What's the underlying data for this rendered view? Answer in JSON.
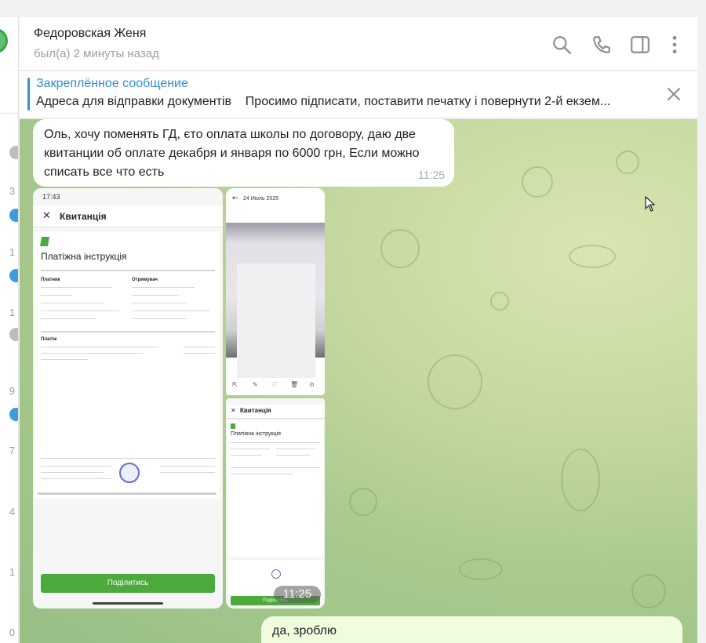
{
  "chat": {
    "title": "Федоровская Женя",
    "status": "был(а) 2 минуты назад"
  },
  "sidebar_partial": {
    "numbers": [
      "3",
      "1",
      "1",
      "9",
      "7",
      "4",
      "1",
      "0"
    ]
  },
  "pinned": {
    "title": "Закреплённое сообщение",
    "text": "Адреса для відправки документів    Просимо підписати, поставити печатку і повернути 2-й екзем..."
  },
  "messages": [
    {
      "direction": "in",
      "text": "Оль, хочу поменять ГД, єто оплата школы по договору, даю две квитанции об оплате декабря и января по 6000 грн, Если можно списать все что есть",
      "time": "11:25"
    },
    {
      "direction": "in",
      "type": "album",
      "time": "11:25",
      "shots": [
        {
          "status_time": "17:43",
          "title": "Квитанція",
          "doc_heading": "Платіжна інструкція",
          "labels": [
            "Платник",
            "Отримувач",
            "Платіж"
          ],
          "button": "Поділитись"
        },
        {
          "date": "24 Июль 2025"
        },
        {
          "title": "Квитанція",
          "doc_heading": "Платіжна інструкція",
          "button": "Поділитись"
        }
      ]
    },
    {
      "direction": "out",
      "text": "да, зроблю"
    }
  ],
  "colors": {
    "accent": "#2f8ed6",
    "outgoing_bubble": "#effdde",
    "incoming_bubble": "#ffffff",
    "privat_green": "#4caa3d"
  },
  "icons": [
    "search-icon",
    "phone-icon",
    "sidebar-toggle-icon",
    "more-vertical-icon",
    "close-icon"
  ]
}
